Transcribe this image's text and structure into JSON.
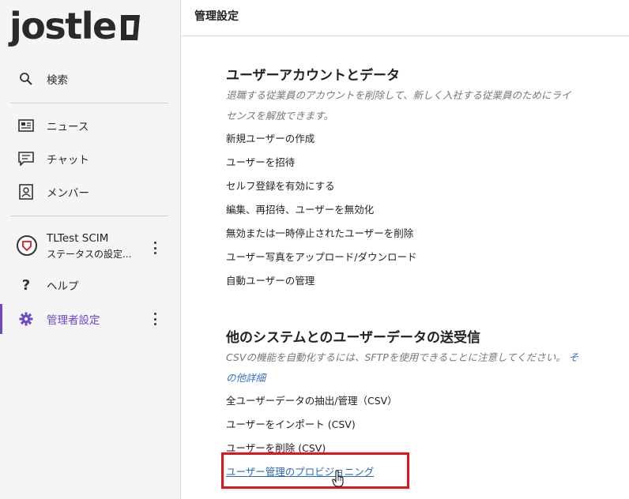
{
  "app": {
    "logo_text": "jostle"
  },
  "sidebar": {
    "search": "検索",
    "news": "ニュース",
    "chat": "チャット",
    "members": "メンバー",
    "profile_name": "TLTest SCIM",
    "profile_status": "ステータスの設定...",
    "help": "ヘルプ",
    "admin": "管理者設定"
  },
  "header": {
    "title": "管理設定"
  },
  "sections": [
    {
      "title": "ユーザーアカウントとデータ",
      "desc_line1": "退職する従業員のアカウントを削除して、新しく入社する従業員のためにライ",
      "desc_line2": "センスを解放できます。",
      "items": [
        "新規ユーザーの作成",
        "ユーザーを招待",
        "セルフ登録を有効にする",
        "編集、再招待、ユーザーを無効化",
        "無効または一時停止されたユーザーを削除",
        "ユーザー写真をアップロード/ダウンロード",
        "自動ユーザーの管理"
      ]
    },
    {
      "title": "他のシステムとのユーザーデータの送受信",
      "desc_line1": "CSVの機能を自動化するには、SFTPを使用できることに注意してください。",
      "desc_more_a": "そ",
      "desc_more_b": "の他詳細",
      "items": [
        "全ユーザーデータの抽出/管理（CSV）",
        "ユーザーをインポート (CSV)",
        "ユーザーを削除 (CSV)",
        "ユーザー管理のプロビジョニング"
      ]
    }
  ],
  "colors": {
    "accent": "#6e46c7",
    "link": "#2f67b8",
    "highlight": "#e0141e"
  }
}
